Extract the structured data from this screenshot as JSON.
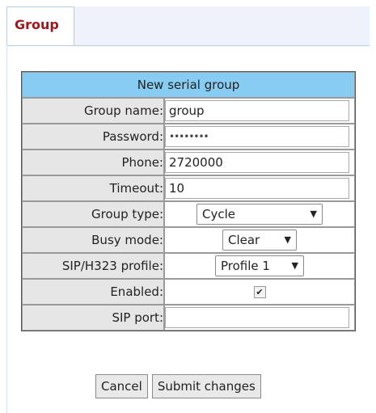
{
  "tab": {
    "label": "Group"
  },
  "form": {
    "title": "New serial group",
    "group_name": {
      "label": "Group name:",
      "value": "group"
    },
    "password": {
      "label": "Password:",
      "value": "••••••••"
    },
    "phone": {
      "label": "Phone:",
      "value": "2720000"
    },
    "timeout": {
      "label": "Timeout:",
      "value": "10"
    },
    "group_type": {
      "label": "Group type:",
      "value": "Cycle"
    },
    "busy_mode": {
      "label": "Busy mode:",
      "value": "Clear"
    },
    "profile": {
      "label": "SIP/H323 profile:",
      "value": "Profile 1"
    },
    "enabled": {
      "label": "Enabled:",
      "checked": true,
      "mark": "✔"
    },
    "sip_port": {
      "label": "SIP port:",
      "value": ""
    }
  },
  "buttons": {
    "cancel": "Cancel",
    "submit": "Submit changes"
  },
  "icons": {
    "dropdown": "dropdown-arrow-icon",
    "check": "checkmark-icon"
  },
  "colors": {
    "header": "#87cdf3",
    "tab_text": "#a4161a",
    "label_bg": "#e6e6e6"
  }
}
